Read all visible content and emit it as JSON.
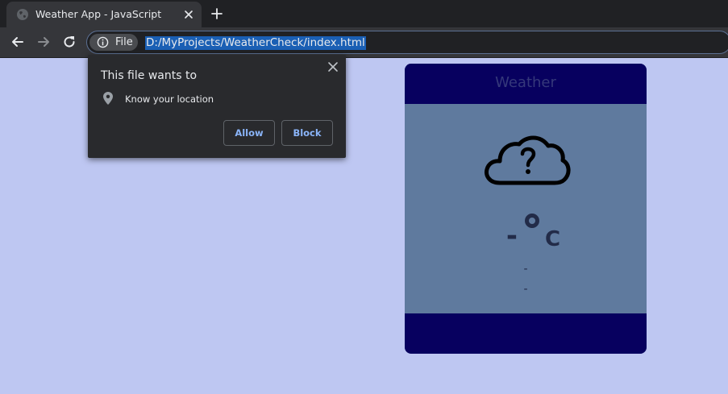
{
  "browser": {
    "tab": {
      "title": "Weather App - JavaScript",
      "favicon": "globe-icon",
      "close_icon": "close-icon"
    },
    "new_tab_icon": "plus-icon",
    "toolbar": {
      "back_icon": "back-arrow-icon",
      "forward_icon": "forward-arrow-icon",
      "reload_icon": "reload-icon",
      "site_info_label": "File",
      "url": "D:/MyProjects/WeatherCheck/index.html"
    },
    "colors": {
      "chrome_dark": "#202124",
      "chrome_tab": "#35363a",
      "url_selection": "#1a5fb4"
    }
  },
  "permission_popup": {
    "title": "This file wants to",
    "permission_icon": "location-pin-icon",
    "permission_text": "Know your location",
    "allow_label": "Allow",
    "block_label": "Block",
    "close_icon": "close-icon"
  },
  "weather_card": {
    "title": "Weather",
    "icon": "cloud-question-icon",
    "temperature": "-",
    "degree_symbol": "°",
    "unit": "C",
    "description_line1": "-",
    "description_line2": "-",
    "colors": {
      "header_footer": "#07005f",
      "body": "#5f7a9e",
      "page_background": "#bec7f2"
    }
  }
}
